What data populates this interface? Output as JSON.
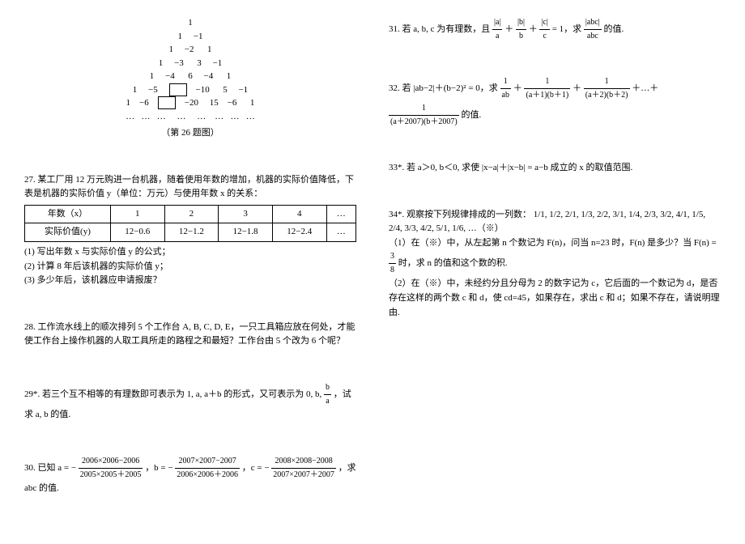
{
  "triangle": {
    "rows": [
      "1",
      "1     −1",
      "1     −2      1",
      "1     −3      3     −1",
      "1     −4      6     −4      1",
      "1     −5     □    −10     5     −1",
      "1    −6    □    −20     15    −6     1",
      "…   …   …     …     …    …   …   …"
    ],
    "caption": "（第 26 题图）"
  },
  "p27": {
    "intro": "27. 某工厂用 12 万元购进一台机器，随着使用年数的增加，机器的实际价值降低，下表是机器的实际价值 y（单位：万元）与使用年数 x 的关系：",
    "table": {
      "headers": [
        "年数（x）",
        "1",
        "2",
        "3",
        "4",
        "…"
      ],
      "values": [
        "实际价值(y)",
        "12−0.6",
        "12−1.2",
        "12−1.8",
        "12−2.4",
        "…"
      ]
    },
    "q1": "(1) 写出年数 x 与实际价值 y 的公式；",
    "q2": "(2) 计算 8 年后该机器的实际价值 y；",
    "q3": "(3) 多少年后，该机器应申请报废？"
  },
  "p28": {
    "text": "28. 工作流水线上的顺次排列 5 个工作台 A, B, C, D, E，一只工具箱应放在何处，才能使工作台上操作机器的人取工具所走的路程之和最短？工作台由 5 个改为 6 个呢？"
  },
  "p29": {
    "prefix": "29*. 若三个互不相等的有理数即可表示为 1, a, a＋b 的形式，又可表示为 0, b, ",
    "frac_n": "b",
    "frac_d": "a",
    "suffix": "，试求 a, b 的值."
  },
  "p30": {
    "prefix": "30. 已知 a = −",
    "a_n": "2006×2006−2006",
    "a_d": "2005×2005＋2005",
    "mid1": "，b = −",
    "b_n": "2007×2007−2007",
    "b_d": "2006×2006＋2006",
    "mid2": "，c = −",
    "c_n": "2008×2008−2008",
    "c_d": "2007×2007＋2007",
    "suffix": "，求 abc 的值."
  },
  "p31": {
    "prefix": "31. 若 a, b, c 为有理数，且 ",
    "t1n": "|a|",
    "t1d": "a",
    "plus": "＋",
    "t2n": "|b|",
    "t2d": "b",
    "t3n": "|c|",
    "t3d": "c",
    "eq": " = 1，求 ",
    "r_n": "|abc|",
    "r_d": "abc",
    "suffix": " 的值."
  },
  "p32": {
    "prefix": "32. 若 |ab−2|＋(b−2)² = 0，求 ",
    "t1n": "1",
    "t1d": "ab",
    "t2n": "1",
    "t2d": "(a＋1)(b＋1)",
    "t3n": "1",
    "t3d": "(a＋2)(b＋2)",
    "dots": "＋…＋",
    "t4n": "1",
    "t4d": "(a＋2007)(b＋2007)",
    "suffix": " 的值."
  },
  "p33": {
    "text": "33*. 若 a＞0, b＜0, 求使 |x−a|＋|x−b| = a−b 成立的 x 的取值范围."
  },
  "p34": {
    "prefix": "34*. 观察按下列规律排成的一列数：",
    "seq": "1/1, 1/2, 2/1, 1/3, 2/2, 3/1, 1/4, 2/3, 3/2, 4/1, 1/5, 2/4, 3/3, 4/2, 5/1, 1/6, …（※）",
    "q1a": "（1）在（※）中，从左起第 n 个数记为 F(n)，问当 n=23 时，F(n) 是多少？当 F(n) = ",
    "q1_fn": "3",
    "q1_fd": "8",
    "q1b": " 时，求 n 的值和这个数的积.",
    "q2": "（2）在（※）中，未经约分且分母为 2 的数字记为 c，它后面的一个数记为 d，是否存在这样的两个数 c 和 d，使 cd=45，如果存在，求出 c 和 d；如果不存在，请说明理由."
  }
}
